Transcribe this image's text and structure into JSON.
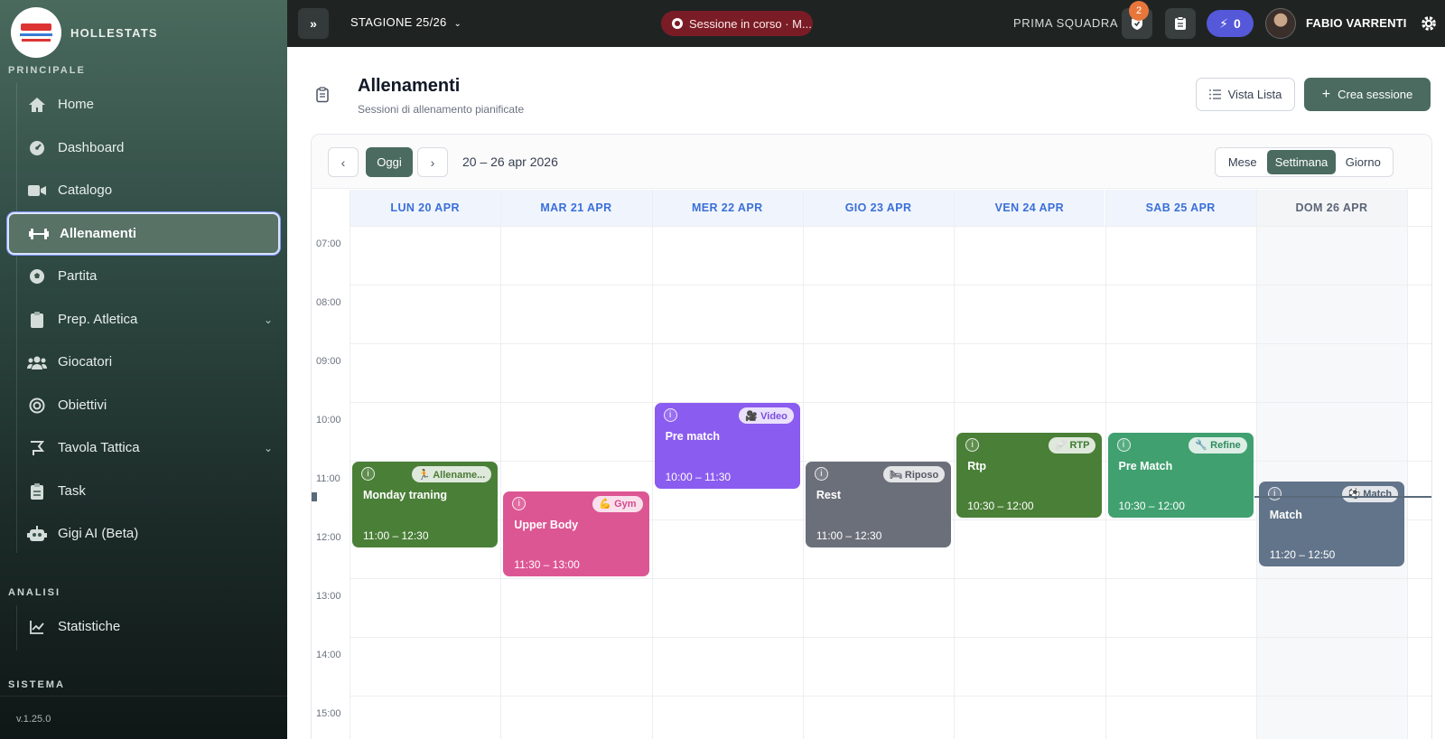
{
  "app": {
    "brand": "HOLLESTATS",
    "version": "v.1.25.0"
  },
  "sidebar": {
    "sections": {
      "principale": "PRINCIPALE",
      "analisi": "ANALISI",
      "sistema": "SISTEMA"
    },
    "items": [
      {
        "label": "Home",
        "icon": "home-icon"
      },
      {
        "label": "Dashboard",
        "icon": "gauge-icon"
      },
      {
        "label": "Catalogo",
        "icon": "video-camera-icon"
      },
      {
        "label": "Allenamenti",
        "icon": "dumbbell-icon",
        "active": true
      },
      {
        "label": "Partita",
        "icon": "soccer-ball-icon"
      },
      {
        "label": "Prep. Atletica",
        "icon": "clipboard-icon",
        "expandable": true
      },
      {
        "label": "Giocatori",
        "icon": "users-icon"
      },
      {
        "label": "Obiettivi",
        "icon": "target-icon"
      },
      {
        "label": "Tavola Tattica",
        "icon": "tactics-board-icon",
        "expandable": true
      },
      {
        "label": "Task",
        "icon": "clipboard-list-icon"
      },
      {
        "label": "Gigi AI (Beta)",
        "icon": "robot-icon"
      }
    ],
    "analisi_items": [
      {
        "label": "Statistiche",
        "icon": "line-chart-icon"
      }
    ]
  },
  "topbar": {
    "expand_label": "»",
    "season": "STAGIONE 25/26",
    "live_session": "Sessione in corso · M...",
    "team": "PRIMA SQUADRA",
    "notification_count": "2",
    "bolt_count": "0",
    "user_name": "FABIO VARRENTI"
  },
  "page": {
    "title": "Allenamenti",
    "subtitle": "Sessioni di allenamento pianificate",
    "vista_lista": "Vista Lista",
    "crea_sessione": "Crea sessione"
  },
  "calendar": {
    "today_label": "Oggi",
    "range": "20 – 26 apr 2026",
    "views": [
      "Mese",
      "Settimana",
      "Giorno"
    ],
    "active_view": "Settimana",
    "days": [
      "LUN 20 APR",
      "MAR 21 APR",
      "MER 22 APR",
      "GIO 23 APR",
      "VEN 24 APR",
      "SAB 25 APR",
      "DOM 26 APR"
    ],
    "hours": [
      "07:00",
      "08:00",
      "09:00",
      "10:00",
      "11:00",
      "12:00",
      "13:00",
      "14:00",
      "15:00"
    ],
    "events": [
      {
        "day": 0,
        "title": "Monday traning",
        "time": "11:00 – 12:30",
        "tag": "🏃 Allename...",
        "tag_color": "#4a7a35",
        "color": "#4a7f37",
        "start": 11.0,
        "end": 12.5
      },
      {
        "day": 1,
        "title": "Upper Body",
        "time": "11:30 – 13:00",
        "tag": "💪 Gym",
        "tag_color": "#d44a8e",
        "color": "#dd5694",
        "start": 11.5,
        "end": 13.0
      },
      {
        "day": 2,
        "title": "Pre match",
        "time": "10:00 – 11:30",
        "tag": "🎥 Video",
        "tag_color": "#7a4ee0",
        "color": "#8b5cf0",
        "start": 10.0,
        "end": 11.5
      },
      {
        "day": 3,
        "title": "Rest",
        "time": "11:00 – 12:30",
        "tag": "🛏 Riposo",
        "tag_color": "#555a66",
        "color": "#6b6f7a",
        "start": 11.0,
        "end": 12.5
      },
      {
        "day": 4,
        "title": "Rtp",
        "time": "10:30 – 12:00",
        "tag": "🩹 RTP",
        "tag_color": "#3f7a2f",
        "color": "#4a7f37",
        "start": 10.5,
        "end": 12.0
      },
      {
        "day": 5,
        "title": "Pre Match",
        "time": "10:30 – 12:00",
        "tag": "🔧 Refine",
        "tag_color": "#2f8a5e",
        "color": "#40a070",
        "start": 10.5,
        "end": 12.0
      },
      {
        "day": 6,
        "title": "Match",
        "time": "11:20 – 12:50",
        "tag": "⚽ Match",
        "tag_color": "#4f5d6e",
        "color": "#62748a",
        "start": 11.333,
        "end": 12.833
      }
    ],
    "now_hour": 11.6
  }
}
